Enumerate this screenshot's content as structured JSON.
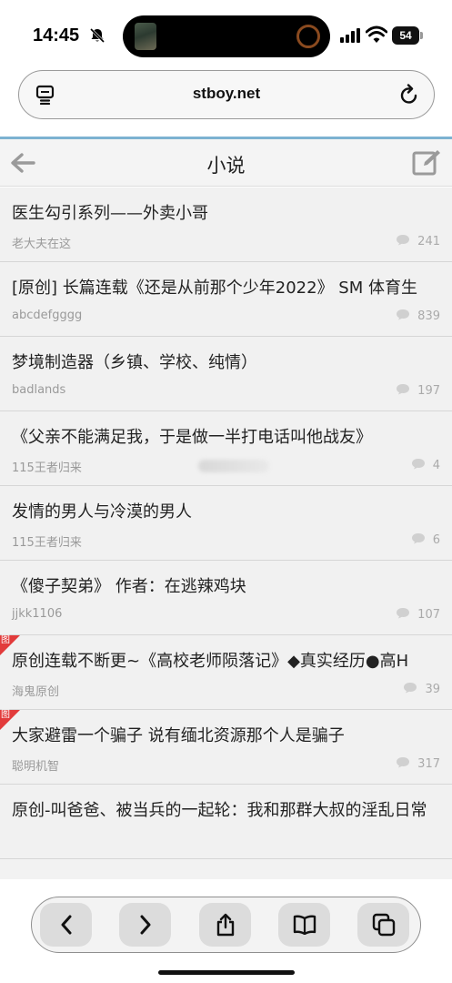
{
  "status_bar": {
    "time": "14:45",
    "battery": "54",
    "icons": [
      "bell-slash-icon",
      "signal-icon",
      "wifi-icon",
      "battery-icon"
    ]
  },
  "browser": {
    "url": "stboy.net",
    "icons": [
      "tabs-icon",
      "reload-icon"
    ]
  },
  "header": {
    "title": "小说",
    "accent_color": "#7cb2d1"
  },
  "posts": [
    {
      "title": "医生勾引系列——外卖小哥",
      "author": "老大夫在这",
      "comments": "241",
      "tag": ""
    },
    {
      "title": "[原创] 长篇连载《还是从前那个少年2022》 SM 体育生",
      "author": "abcdefgggg",
      "comments": "839",
      "tag": ""
    },
    {
      "title": "梦境制造器（乡镇、学校、纯情）",
      "author": "badlands",
      "comments": "197",
      "tag": ""
    },
    {
      "title": "《父亲不能满足我，于是做一半打电话叫他战友》",
      "author": "115王者归来",
      "comments": "4",
      "tag": ""
    },
    {
      "title": "发情的男人与冷漠的男人",
      "author": "115王者归来",
      "comments": "6",
      "tag": ""
    },
    {
      "title": "《傻子契弟》 作者：在逃辣鸡块",
      "author": "jjkk1106",
      "comments": "107",
      "tag": ""
    },
    {
      "title": "原创连载不断更~《高校老师陨落记》◆真实经历●高H",
      "author": "海鬼原创",
      "comments": "39",
      "tag": "图"
    },
    {
      "title": "大家避雷一个骗子 说有缅北资源那个人是骗子",
      "author": "聪明机智",
      "comments": "317",
      "tag": "图"
    },
    {
      "title": "原创-叫爸爸、被当兵的一起轮：我和那群大叔的淫乱日常",
      "author": "",
      "comments": "",
      "tag": ""
    }
  ],
  "toolbar": {
    "buttons": [
      "back-icon",
      "forward-icon",
      "share-icon",
      "bookmarks-icon",
      "tabs-overview-icon"
    ]
  }
}
